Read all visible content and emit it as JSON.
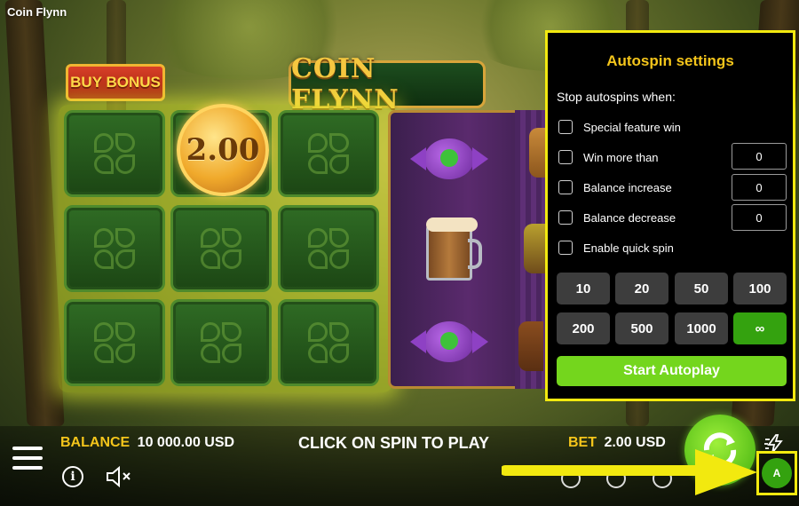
{
  "app": {
    "title": "Coin Flynn"
  },
  "game": {
    "buy_bonus_label": "BUY BONUS",
    "logo_text": "COIN FLYNN",
    "coin_value": "2.00"
  },
  "autospin": {
    "title": "Autospin settings",
    "stop_label": "Stop autospins when:",
    "options": [
      {
        "label": "Special feature win",
        "checked": false
      },
      {
        "label": "Win more than",
        "checked": false,
        "value": "0"
      },
      {
        "label": "Balance increase",
        "checked": false,
        "value": "0"
      },
      {
        "label": "Balance decrease",
        "checked": false,
        "value": "0"
      },
      {
        "label": "Enable quick spin",
        "checked": false
      }
    ],
    "counts": [
      "10",
      "20",
      "50",
      "100",
      "200",
      "500",
      "1000",
      "∞"
    ],
    "selected_count": "∞",
    "start_label": "Start Autoplay"
  },
  "bottom_bar": {
    "balance_label": "BALANCE",
    "balance_value": "10 000.00 USD",
    "prompt": "CLICK ON SPIN TO PLAY",
    "bet_label": "BET",
    "bet_value": "2.00 USD",
    "info_symbol": "i",
    "autoplay_symbol": "A"
  },
  "colors": {
    "highlight": "#f2e90f",
    "title_gold": "#f4c51b",
    "start_green": "#74d61d",
    "selected_green": "#34a20f"
  }
}
